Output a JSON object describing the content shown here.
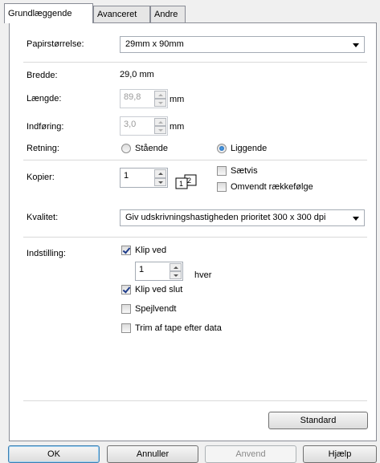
{
  "tabs": [
    {
      "label": "Grundlæggende"
    },
    {
      "label": "Avanceret"
    },
    {
      "label": "Andre"
    }
  ],
  "paper_size": {
    "label": "Papirstørrelse:",
    "value": "29mm x 90mm"
  },
  "width": {
    "label": "Bredde:",
    "value": "29,0 mm"
  },
  "length": {
    "label": "Længde:",
    "value": "89,8",
    "unit": "mm"
  },
  "feed": {
    "label": "Indføring:",
    "value": "3,0",
    "unit": "mm"
  },
  "orientation": {
    "label": "Retning:",
    "portrait": "Stående",
    "landscape": "Liggende",
    "selected": "landscape"
  },
  "copies": {
    "label": "Kopier:",
    "value": "1",
    "collate": "Sætvis",
    "reverse": "Omvendt rækkefølge"
  },
  "quality": {
    "label": "Kvalitet:",
    "value": "Giv udskrivningshastigheden prioritet 300 x 300 dpi"
  },
  "settings": {
    "label": "Indstilling:",
    "cut": "Klip ved",
    "cut_every_value": "1",
    "cut_every_unit": "hver",
    "cut_at_end": "Klip ved slut",
    "mirror": "Spejlvendt",
    "trim": "Trim af tape efter data"
  },
  "standard_button": "Standard",
  "buttons": {
    "ok": "OK",
    "cancel": "Annuller",
    "apply": "Anvend",
    "help": "Hjælp"
  }
}
